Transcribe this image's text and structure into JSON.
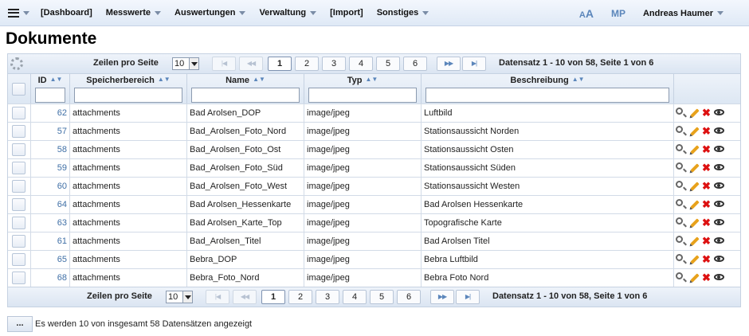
{
  "menu": {
    "items": [
      "[Dashboard]",
      "Messwerte",
      "Auswertungen",
      "Verwaltung",
      "[Import]",
      "Sonstiges"
    ],
    "aa_small": "A",
    "aa_big": "A",
    "mp": "MP",
    "user": "Andreas Haumer"
  },
  "page": {
    "title": "Dokumente"
  },
  "pager": {
    "rows_label": "Zeilen pro Seite",
    "rows_value": "10",
    "pages": [
      "1",
      "2",
      "3",
      "4",
      "5",
      "6"
    ],
    "current_page": "1",
    "first": "|◀",
    "prev": "◀◀",
    "next": "▶▶",
    "last": "▶|",
    "summary": "Datensatz 1 - 10 von 58, Seite 1 von 6"
  },
  "columns": {
    "id": "ID",
    "storage": "Speicherbereich",
    "name": "Name",
    "type": "Typ",
    "desc": "Beschreibung"
  },
  "rows": [
    {
      "id": "62",
      "storage": "attachments",
      "name": "Bad Arolsen_DOP",
      "type": "image/jpeg",
      "desc": "Luftbild"
    },
    {
      "id": "57",
      "storage": "attachments",
      "name": "Bad_Arolsen_Foto_Nord",
      "type": "image/jpeg",
      "desc": "Stationsaussicht Norden"
    },
    {
      "id": "58",
      "storage": "attachments",
      "name": "Bad_Arolsen_Foto_Ost",
      "type": "image/jpeg",
      "desc": "Stationsaussicht Osten"
    },
    {
      "id": "59",
      "storage": "attachments",
      "name": "Bad_Arolsen_Foto_Süd",
      "type": "image/jpeg",
      "desc": "Stationsaussicht Süden"
    },
    {
      "id": "60",
      "storage": "attachments",
      "name": "Bad_Arolsen_Foto_West",
      "type": "image/jpeg",
      "desc": "Stationsaussicht Westen"
    },
    {
      "id": "64",
      "storage": "attachments",
      "name": "Bad Arolsen_Hessenkarte",
      "type": "image/jpeg",
      "desc": "Bad Arolsen Hessenkarte"
    },
    {
      "id": "63",
      "storage": "attachments",
      "name": "Bad Arolsen_Karte_Top",
      "type": "image/jpeg",
      "desc": "Topografische Karte"
    },
    {
      "id": "61",
      "storage": "attachments",
      "name": "Bad_Arolsen_Titel",
      "type": "image/jpeg",
      "desc": "Bad Arolsen Titel"
    },
    {
      "id": "65",
      "storage": "attachments",
      "name": "Bebra_DOP",
      "type": "image/jpeg",
      "desc": "Bebra Luftbild"
    },
    {
      "id": "68",
      "storage": "attachments",
      "name": "Bebra_Foto_Nord",
      "type": "image/jpeg",
      "desc": "Bebra Foto Nord"
    }
  ],
  "footer": {
    "button": "...",
    "text": "Es werden 10 von insgesamt 58 Datensätzen angezeigt"
  }
}
